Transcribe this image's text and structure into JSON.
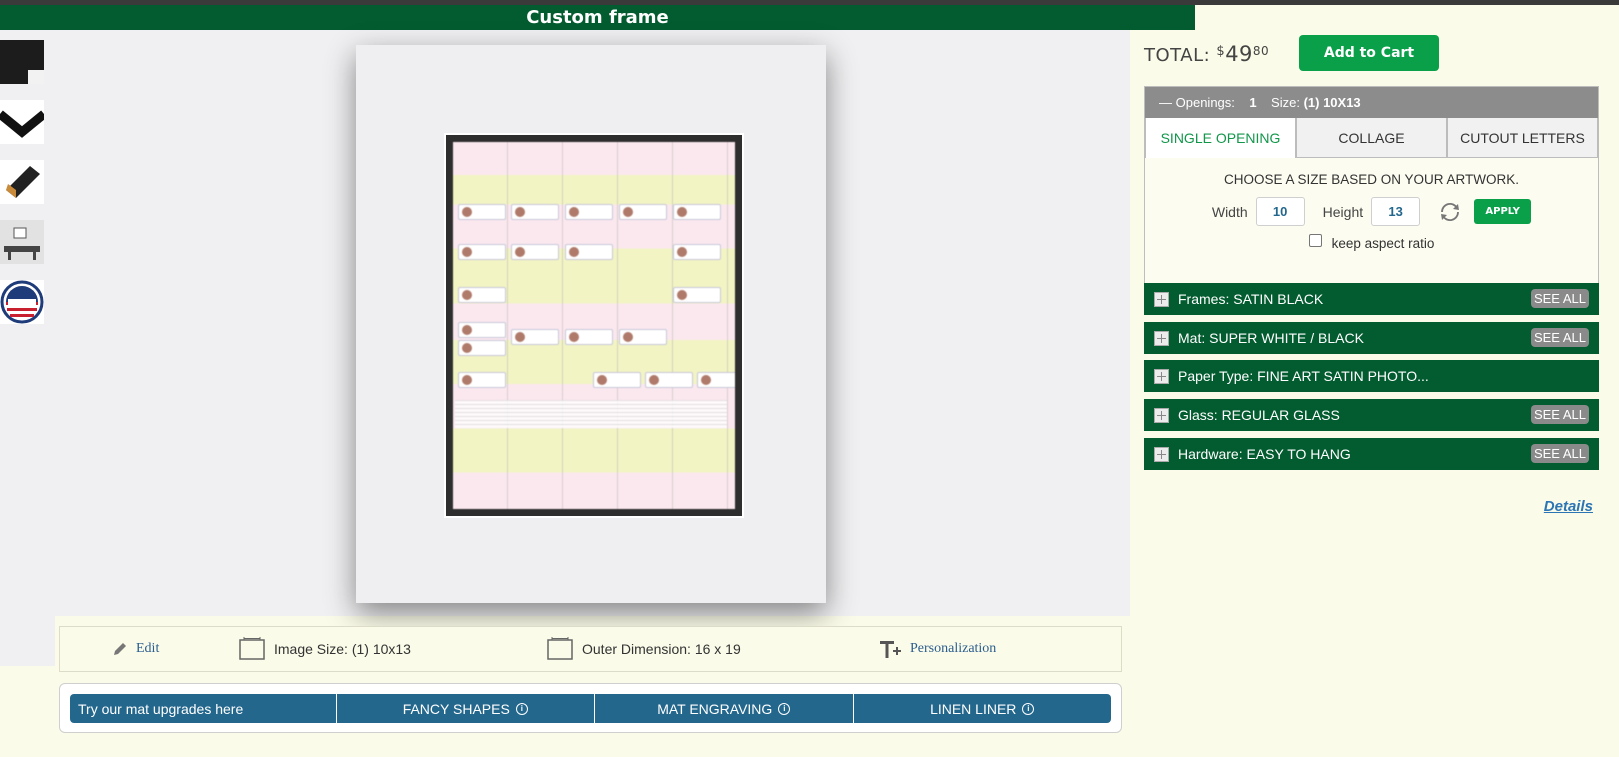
{
  "header": {
    "title": "Custom frame"
  },
  "total": {
    "label": "TOTAL:",
    "currency": "$",
    "amount": "49",
    "cents": "80"
  },
  "cart_button": "Add to Cart",
  "openings": {
    "toggle": "—",
    "label": "Openings:",
    "count": "1",
    "size_label": "Size:",
    "size_value": "(1) 10X13"
  },
  "tabs": [
    "SINGLE OPENING",
    "COLLAGE",
    "CUTOUT LETTERS"
  ],
  "size_form": {
    "title": "CHOOSE A SIZE BASED ON YOUR ARTWORK.",
    "width_label": "Width",
    "width_value": "10",
    "height_label": "Height",
    "height_value": "13",
    "apply": "APPLY",
    "aspect_label": "keep aspect ratio"
  },
  "options": [
    {
      "label": "Frames: SATIN BLACK",
      "see_all": "SEE ALL"
    },
    {
      "label": "Mat: SUPER WHITE / BLACK",
      "see_all": "SEE ALL"
    },
    {
      "label": "Paper Type: FINE ART SATIN PHOTO..."
    },
    {
      "label": "Glass: REGULAR GLASS",
      "see_all": "SEE ALL"
    },
    {
      "label": "Hardware: EASY TO HANG",
      "see_all": "SEE ALL"
    }
  ],
  "details_link": "Details",
  "info_bar": {
    "edit": "Edit",
    "image_size": "Image Size: (1) 10x13",
    "outer_dimension": "Outer Dimension: 16 x 19",
    "personalization": "Personalization"
  },
  "upgrades": {
    "intro": "Try our mat upgrades here",
    "items": [
      "FANCY SHAPES",
      "MAT ENGRAVING",
      "LINEN LINER"
    ],
    "info_glyph": "i"
  },
  "thumbnails": [
    "frame-corner-thumbnail",
    "frame-profile-thumbnail",
    "frame-side-thumbnail",
    "room-scene-thumbnail",
    "made-in-usa-badge"
  ],
  "colors": {
    "brand_green": "#035c30",
    "button_green": "#0aa04a",
    "upgrade_blue": "#24678d"
  }
}
